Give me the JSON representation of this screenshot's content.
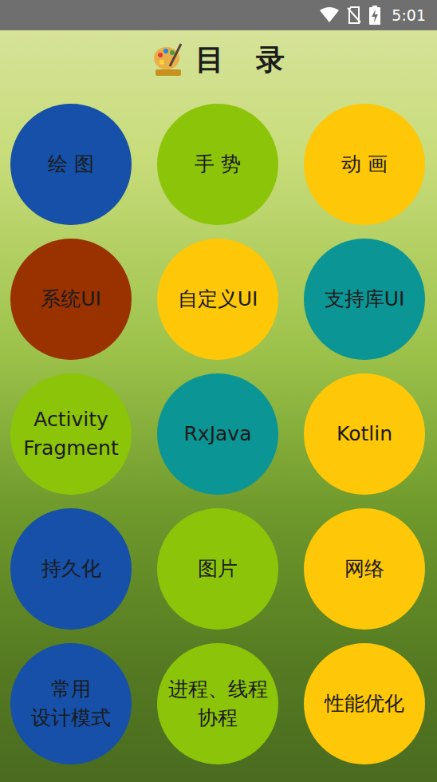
{
  "status_bar": {
    "time": "5:01"
  },
  "header": {
    "title": "目 录"
  },
  "menu": [
    {
      "lines": [
        "绘 图"
      ],
      "color": "#1650a8"
    },
    {
      "lines": [
        "手 势"
      ],
      "color": "#8cc40a"
    },
    {
      "lines": [
        "动 画"
      ],
      "color": "#fec708"
    },
    {
      "lines": [
        "系统UI"
      ],
      "color": "#9a3200"
    },
    {
      "lines": [
        "自定义UI"
      ],
      "color": "#fec708"
    },
    {
      "lines": [
        "支持库UI"
      ],
      "color": "#0c9595"
    },
    {
      "lines": [
        "Activity",
        "Fragment"
      ],
      "color": "#8cc40a"
    },
    {
      "lines": [
        "RxJava"
      ],
      "color": "#0c9595"
    },
    {
      "lines": [
        "Kotlin"
      ],
      "color": "#fec708"
    },
    {
      "lines": [
        "持久化"
      ],
      "color": "#1650a8"
    },
    {
      "lines": [
        "图片"
      ],
      "color": "#8cc40a"
    },
    {
      "lines": [
        "网络"
      ],
      "color": "#fec708"
    },
    {
      "lines": [
        "常用",
        "设计模式"
      ],
      "color": "#1650a8"
    },
    {
      "lines": [
        "进程、线程",
        "协程"
      ],
      "color": "#8cc40a"
    },
    {
      "lines": [
        "性能优化"
      ],
      "color": "#fec708"
    }
  ]
}
